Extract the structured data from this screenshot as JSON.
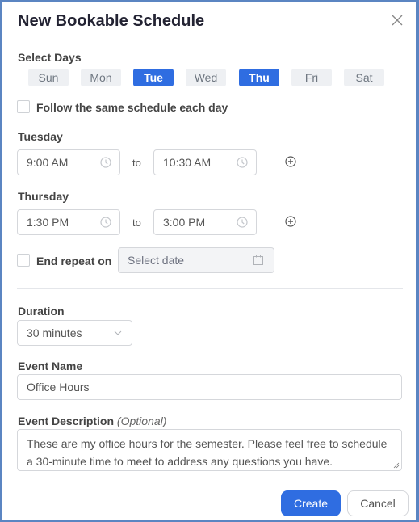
{
  "dialog": {
    "title": "New Bookable Schedule",
    "close_icon": "close-icon"
  },
  "select_days": {
    "label": "Select Days",
    "days": [
      {
        "label": "Sun",
        "selected": false
      },
      {
        "label": "Mon",
        "selected": false
      },
      {
        "label": "Tue",
        "selected": true
      },
      {
        "label": "Wed",
        "selected": false
      },
      {
        "label": "Thu",
        "selected": true
      },
      {
        "label": "Fri",
        "selected": false
      },
      {
        "label": "Sat",
        "selected": false
      }
    ]
  },
  "same_schedule": {
    "label": "Follow the same schedule each day",
    "checked": false
  },
  "schedules": [
    {
      "day": "Tuesday",
      "start": "9:00 AM",
      "to": "to",
      "end": "10:30 AM"
    },
    {
      "day": "Thursday",
      "start": "1:30 PM",
      "to": "to",
      "end": "3:00 PM"
    }
  ],
  "end_repeat": {
    "label": "End repeat on",
    "checked": false,
    "placeholder": "Select date"
  },
  "duration": {
    "label": "Duration",
    "value": "30 minutes"
  },
  "event_name": {
    "label": "Event Name",
    "value": "Office Hours"
  },
  "event_description": {
    "label": "Event Description",
    "optional": "(Optional)",
    "value": "These are my office hours for the semester.  Please feel free to schedule a 30-minute time to meet to address any questions you have."
  },
  "buttons": {
    "create": "Create",
    "cancel": "Cancel"
  },
  "colors": {
    "accent": "#2f6de1",
    "frame": "#5b85c2"
  }
}
